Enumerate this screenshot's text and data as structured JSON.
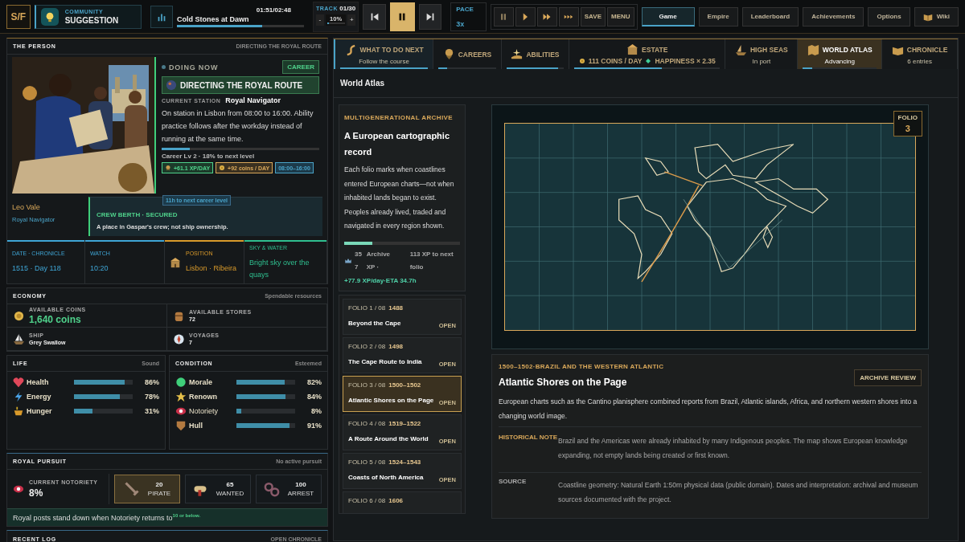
{
  "topbar": {
    "logo": "S/F",
    "community": {
      "label": "COMMUNITY",
      "title": "SUGGESTION"
    },
    "music": {
      "time": "01:51/02:48",
      "title": "Cold Stones at Dawn",
      "level": 0.67
    },
    "track": {
      "label": "TRACK",
      "count": "01/30",
      "minus": "-",
      "volume": "10%",
      "level": 0.1,
      "plus": "+"
    },
    "transport": [
      {
        "kind": "prev",
        "selected": false
      },
      {
        "kind": "pause",
        "selected": true
      },
      {
        "kind": "next",
        "selected": false
      }
    ],
    "pace": {
      "label": "PACE",
      "value": "3x"
    },
    "speeds": [
      {
        "kind": "pause"
      },
      {
        "kind": "play"
      },
      {
        "kind": "fast"
      },
      {
        "kind": "faster"
      }
    ],
    "actions": [
      "SAVE",
      "MENU"
    ],
    "nav": [
      {
        "label": "Game",
        "selected": true,
        "kind": "text"
      },
      {
        "label": "Empire",
        "selected": false,
        "kind": "text"
      },
      {
        "label": "Leaderboard",
        "selected": false,
        "kind": "text"
      },
      {
        "label": "Achievements",
        "selected": false,
        "kind": "text"
      },
      {
        "label": "Options",
        "selected": false,
        "kind": "text"
      },
      {
        "label": "Wiki",
        "selected": false,
        "kind": "book"
      }
    ]
  },
  "person": {
    "title": "THE PERSON",
    "context": "DIRECTING THE ROYAL ROUTE",
    "name": "Leo Vale",
    "role": "Royal Navigator",
    "doing_label": "DOING NOW",
    "badge": "CAREER",
    "activity": "DIRECTING THE ROYAL ROUTE",
    "station_label": "CURRENT STATION",
    "station": "Royal Navigator",
    "description": "On station in Lisbon from 08:00 to 16:00. Ability practice follows after the workday instead of running at the same time.",
    "progress": {
      "level": 0.18,
      "label": "Career Lv 2 · 18% to next level"
    },
    "chips": [
      {
        "kind": "xp",
        "text": "+61.1 XP/DAY"
      },
      {
        "kind": "coins",
        "text": "+92 coins / DAY"
      },
      {
        "kind": "hours",
        "text": "08:00–16:00"
      }
    ],
    "tooltip": "11h to next career level",
    "berth": {
      "title": "CREW BERTH · SECURED",
      "text": "A place in Gaspar's crew; not ship ownership."
    }
  },
  "info": [
    {
      "kind": "date",
      "label": "DATE · CHRONICLE",
      "value": "1515 · Day 118",
      "color": "#3fa6d6"
    },
    {
      "kind": "time",
      "label": "WATCH",
      "value": "10:20",
      "color": "#3fa6d6"
    },
    {
      "kind": "place",
      "label": "POSITION",
      "value": "Lisbon · Ribeira",
      "color": "#d99a2b"
    },
    {
      "kind": "weather",
      "label": "SKY & WATER",
      "value": "Bright sky over the quays",
      "color": "#2fbf8f"
    }
  ],
  "economy": {
    "title": "ECONOMY",
    "note": "Spendable resources",
    "items": [
      {
        "kind": "coins",
        "label": "AVAILABLE COINS",
        "value": "1,640 coins"
      },
      {
        "kind": "stores",
        "label": "AVAILABLE STORES",
        "value": "72"
      },
      {
        "kind": "ship",
        "label": "SHIP",
        "value": "Grey Swallow"
      },
      {
        "kind": "voyages",
        "label": "VOYAGES",
        "value": "7"
      }
    ]
  },
  "life": {
    "title": "LIFE",
    "note": "Sound",
    "stats": [
      {
        "kind": "health",
        "name": "Health",
        "level": 0.86,
        "reading": "86%"
      },
      {
        "kind": "energy",
        "name": "Energy",
        "level": 0.78,
        "reading": "78%"
      },
      {
        "kind": "hunger",
        "name": "Hunger",
        "level": 0.31,
        "reading": "31%"
      }
    ]
  },
  "condition": {
    "title": "CONDITION",
    "note": "Esteemed",
    "stats": [
      {
        "kind": "morale",
        "name": "Morale",
        "level": 0.82,
        "reading": "82%"
      },
      {
        "kind": "renown",
        "name": "Renown",
        "level": 0.84,
        "reading": "84%"
      },
      {
        "kind": "notoriety",
        "name": "Notoriety",
        "level": 0.08,
        "reading": "8%"
      },
      {
        "kind": "hull",
        "name": "Hull",
        "level": 0.91,
        "reading": "91%"
      }
    ]
  },
  "pursuit": {
    "title": "ROYAL PURSUIT",
    "note": "No active pursuit",
    "current_label": "CURRENT NOTORIETY",
    "current": "8%",
    "thresholds": [
      {
        "kind": "pirate",
        "value": "20",
        "label": "PIRATE",
        "selected": true
      },
      {
        "kind": "wanted",
        "value": "65",
        "label": "WANTED",
        "selected": false
      },
      {
        "kind": "arrest",
        "value": "100",
        "label": "ARREST",
        "selected": false
      }
    ],
    "message": "Royal posts stand down when Notoriety returns to$^{10 or below.}$"
  },
  "log": {
    "title": "RECENT LOG",
    "action": "OPEN CHRONICLE"
  },
  "sections": [
    {
      "kind": "route",
      "title": "WHAT TO DO NEXT",
      "subtitle": "Follow the course",
      "level": 1,
      "selected": false
    },
    {
      "kind": "careers",
      "title": "CAREERS",
      "level": 0.15,
      "selected": false
    },
    {
      "kind": "abilities",
      "title": "ABILITIES",
      "level": 0.9,
      "selected": false
    },
    {
      "kind": "estate",
      "title": "ESTATE",
      "stats": [
        "111 COINS / DAY",
        "HAPPINESS × 2.35"
      ],
      "level": 0.6,
      "selected": false
    },
    {
      "kind": "seas",
      "title": "HIGH SEAS",
      "subtitle": "In port",
      "selected": false
    },
    {
      "kind": "atlas",
      "title": "WORLD ATLAS",
      "subtitle": "Advancing",
      "level": 0.13,
      "selected": true
    },
    {
      "kind": "chronicle",
      "title": "CHRONICLE",
      "subtitle": "6 entries",
      "selected": false
    }
  ],
  "atlas": {
    "title": "World Atlas",
    "archive": {
      "label": "MULTIGENERATIONAL ARCHIVE",
      "title": "A European cartographic record",
      "text": "Each folio marks when coastlines entered European charts—not when inhabited lands began to exist. Peoples already lived, traded and navigated in every region shown.",
      "level": 0.24,
      "xp": "357",
      "xp_label": "Archive XP ·",
      "next": "113 XP to next folio",
      "rate": "+77.9 XP/day·ETA 34.7h"
    },
    "folios": [
      {
        "label": "FOLIO 1 / 08",
        "year": "1488",
        "status": "OPEN",
        "title": "Beyond the Cape",
        "selected": false
      },
      {
        "label": "FOLIO 2 / 08",
        "year": "1498",
        "status": "OPEN",
        "title": "The Cape Route to India",
        "selected": false
      },
      {
        "label": "FOLIO 3 / 08",
        "year": "1500–1502",
        "status": "OPEN",
        "title": "Atlantic Shores on the Page",
        "selected": true
      },
      {
        "label": "FOLIO 4 / 08",
        "year": "1519–1522",
        "status": "OPEN",
        "title": "A Route Around the World",
        "selected": false
      },
      {
        "label": "FOLIO 5 / 08",
        "year": "1524–1543",
        "status": "OPEN",
        "title": "Coasts of North America",
        "selected": false
      },
      {
        "label": "FOLIO 6 / 08",
        "year": "1606",
        "selected": false
      }
    ],
    "map": {
      "folio_label": "FOLIO",
      "folio_number": "3"
    },
    "detail": {
      "eyebrow": "1500–1502·BRAZIL AND THE WESTERN ATLANTIC",
      "title": "Atlantic Shores on the Page",
      "button": "ARCHIVE REVIEW",
      "text": "European charts such as the Cantino planisphere combined reports from Brazil, Atlantic islands, Africa, and northern western shores into a changing world image.",
      "notes": [
        {
          "label": "HISTORICAL NOTE",
          "text": "Brazil and the Americas were already inhabited by many Indigenous peoples. The map shows European knowledge expanding, not empty lands being created or first known."
        },
        {
          "label": "SOURCE",
          "text": "Coastline geometry: Natural Earth 1:50m physical data (public domain). Dates and interpretation: archival and museum sources documented with the project."
        }
      ]
    }
  }
}
